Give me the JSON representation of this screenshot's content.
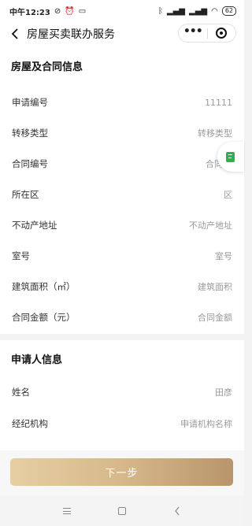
{
  "status_bar": {
    "time": "中午12:23",
    "left_icons": [
      "no-disturb-icon",
      "alarm-icon",
      "message-icon"
    ],
    "right_icons": [
      "bluetooth-icon",
      "signal-icon",
      "signal-icon",
      "wifi-icon"
    ],
    "battery": "62"
  },
  "nav": {
    "title": "房屋买卖联办服务",
    "more": "•••"
  },
  "section_house": {
    "title": "房屋及合同信息",
    "rows": [
      {
        "label": "申请编号",
        "value": "11111"
      },
      {
        "label": "转移类型",
        "value": "转移类型"
      },
      {
        "label": "合同编号",
        "value": "合同"
      },
      {
        "label": "所在区",
        "value": "区"
      },
      {
        "label": "不动产地址",
        "value": "不动产地址"
      },
      {
        "label": "室号",
        "value": "室号"
      },
      {
        "label": "建筑面积（㎡）",
        "value": "建筑面积"
      },
      {
        "label": "合同金额（元）",
        "value": "合同金额"
      }
    ]
  },
  "section_applicant": {
    "title": "申请人信息",
    "rows": [
      {
        "label": "姓名",
        "value": "田彦"
      },
      {
        "label": "经纪机构",
        "value": "申请机构名称"
      }
    ]
  },
  "next_button": "下一步",
  "colors": {
    "button_start": "#e6cfa3",
    "button_end": "#b9956c",
    "float_icon": "#2bb24c"
  }
}
